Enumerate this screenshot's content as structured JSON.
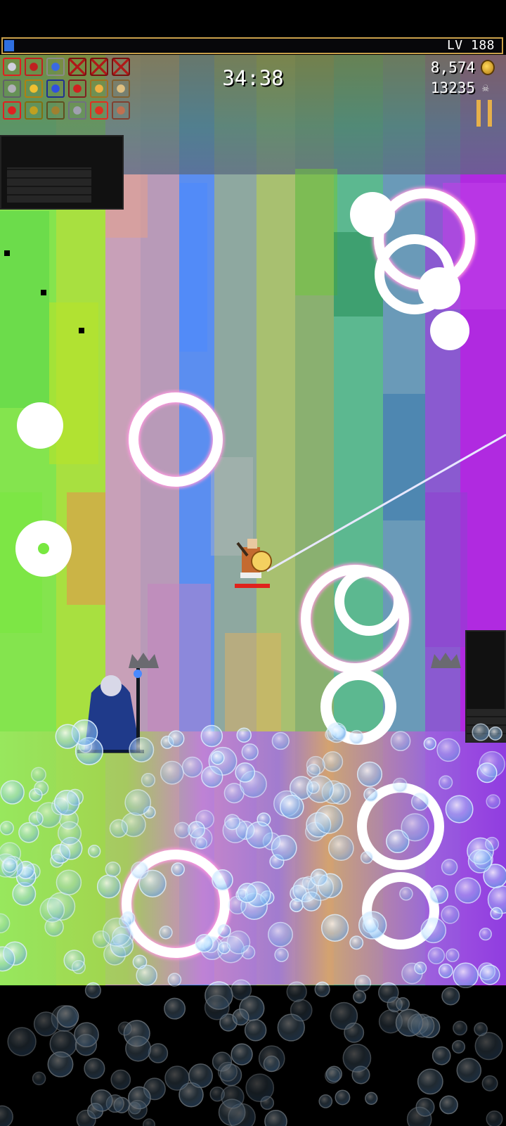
{
  "hud": {
    "level": "LV 188",
    "xp_progress": 0.02,
    "timer": "34:38",
    "gold": "8,574",
    "kills": "13235"
  },
  "icons": {
    "row1": [
      "runetracer-icon",
      "red-cape-icon",
      "magic-wand-icon",
      "empty-slot-icon",
      "empty-slot-icon",
      "empty-slot-icon"
    ],
    "row2": [
      "armor-icon",
      "crown-icon",
      "orb-icon",
      "tome-icon",
      "candle-icon",
      "trident-icon"
    ],
    "row3": [
      "arrow-icon",
      "ring-icon",
      "cage-icon",
      "silver-ring-icon",
      "arrow-left-icon",
      "scroll-icon"
    ]
  },
  "colors": {
    "xp_fill": "#2f6fe0",
    "frame_gold": "#c9a04a",
    "health_bar": "#e0221c"
  },
  "player_health": 1.0
}
